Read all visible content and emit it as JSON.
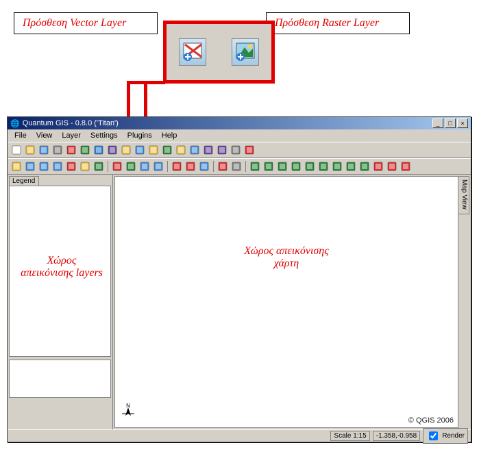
{
  "callouts": {
    "vector": "Πρόσθεση Vector Layer",
    "raster": "Πρόσθεση Raster Layer"
  },
  "zoom_icons": {
    "vector": "add-vector-layer-icon",
    "raster": "add-raster-layer-icon"
  },
  "app": {
    "title": "Quantum GIS - 0.8.0 ('Titan')",
    "window_buttons": {
      "min": "_",
      "max": "□",
      "close": "×"
    }
  },
  "menubar": [
    "File",
    "View",
    "Layer",
    "Settings",
    "Plugins",
    "Help"
  ],
  "toolbar1": [
    "new",
    "open",
    "save",
    "print",
    "add-vector",
    "add-raster",
    "add-wms",
    "add-postgis",
    "new-layer",
    "remove-layer",
    "duplicate",
    "move-up",
    "move-down",
    "toggle",
    "properties",
    "zoom-layer",
    "table",
    "identify"
  ],
  "toolbar2": [
    "pan",
    "zoom-in",
    "zoom-out",
    "zoom-full",
    "zoom-selection",
    "zoom-last",
    "refresh",
    "sep",
    "identify",
    "select",
    "measure-line",
    "measure-area",
    "sep",
    "map-tips",
    "bookmark",
    "new-bookmark",
    "sep",
    "composer",
    "print",
    "sep",
    "plugin1",
    "plugin2",
    "plugin3",
    "plugin4",
    "plugin5",
    "plugin6",
    "plugin7",
    "plugin8",
    "plugin9",
    "plugin10",
    "plugin11",
    "plugin12"
  ],
  "panels": {
    "legend_tab": "Legend",
    "mapview_tab": "Map View"
  },
  "overlays": {
    "layers": "Χώρος απεικόνισης layers",
    "map": "Χώρος απεικόνισης χάρτη"
  },
  "map": {
    "north_label": "N",
    "copyright": "© QGIS 2006"
  },
  "statusbar": {
    "scale": "Scale 1:15",
    "coords": "-1.358,-0.958",
    "render_label": "Render",
    "render_checked": true
  },
  "colors": {
    "accent": "#e00000"
  }
}
